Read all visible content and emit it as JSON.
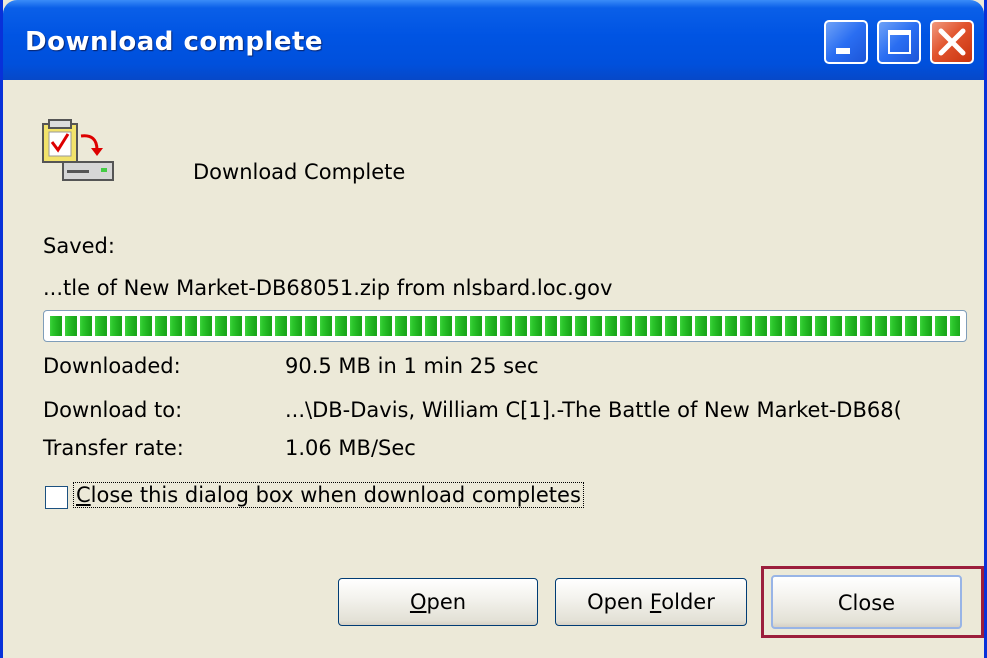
{
  "window": {
    "title": "Download complete"
  },
  "title_buttons": {
    "minimize_icon": "minimize-icon",
    "maximize_icon": "maximize-icon",
    "close_icon": "close-icon"
  },
  "dialog": {
    "icon": "download-complete-icon",
    "heading": "Download Complete",
    "saved_label": "Saved:",
    "saved_file": "...tle of New Market-DB68051.zip from nlsbard.loc.gov",
    "progress_fraction": 1.0,
    "downloaded_label": "Downloaded:",
    "downloaded_value": "90.5 MB in 1 min 25 sec",
    "download_to_label": "Download to:",
    "download_to_value": "...\\DB-Davis, William C[1].-The Battle of New Market-DB68(",
    "transfer_rate_label": "Transfer rate:",
    "transfer_rate_value": "1.06 MB/Sec",
    "close_when_complete": {
      "label": "Close this dialog box when download completes",
      "checked": false
    }
  },
  "buttons": {
    "open": {
      "label": "Open",
      "mnemonic": "O"
    },
    "open_folder": {
      "label": "Open Folder",
      "mnemonic": "F"
    },
    "close": {
      "label": "Close"
    }
  },
  "colors": {
    "titlebar": "#0054e3",
    "dialog_background": "#ece9d8",
    "progress_green": "#2bc52b",
    "highlight_border": "#9c1e3c"
  }
}
